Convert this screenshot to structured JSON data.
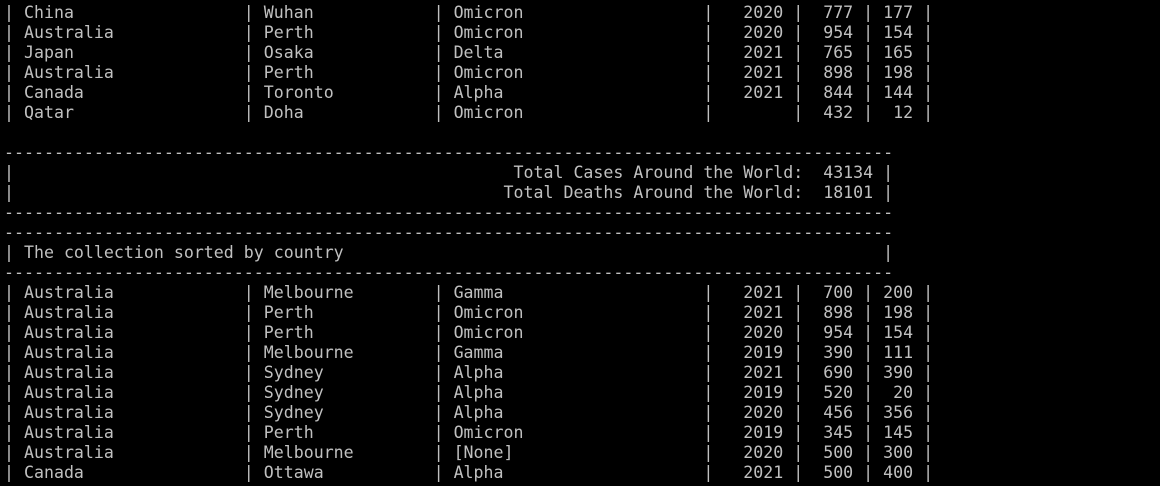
{
  "terminal": {
    "background": "#000000",
    "foreground": "#c0c0c0",
    "lines": [
      "| China                 | Wuhan            | Omicron                  |   2020 |  777 | 177 |",
      "| Australia             | Perth            | Omicron                  |   2020 |  954 | 154 |",
      "| Japan                 | Osaka            | Delta                    |   2021 |  765 | 165 |",
      "| Australia             | Perth            | Omicron                  |   2021 |  898 | 198 |",
      "| Canada                | Toronto          | Alpha                    |   2021 |  844 | 144 |",
      "| Qatar                 | Doha             | Omicron                  |        |  432 |  12 |",
      "",
      "-----------------------------------------------------------------------------------------",
      "|                                                  Total Cases Around the World:  43134 |",
      "|                                                 Total Deaths Around the World:  18101 |",
      "-----------------------------------------------------------------------------------------",
      "-----------------------------------------------------------------------------------------",
      "| The collection sorted by country                                                      |",
      "-----------------------------------------------------------------------------------------",
      "| Australia             | Melbourne        | Gamma                    |   2021 |  700 | 200 |",
      "| Australia             | Perth            | Omicron                  |   2021 |  898 | 198 |",
      "| Australia             | Perth            | Omicron                  |   2020 |  954 | 154 |",
      "| Australia             | Melbourne        | Gamma                    |   2019 |  390 | 111 |",
      "| Australia             | Sydney           | Alpha                    |   2021 |  690 | 390 |",
      "| Australia             | Sydney           | Alpha                    |   2019 |  520 |  20 |",
      "| Australia             | Sydney           | Alpha                    |   2020 |  456 | 356 |",
      "| Australia             | Perth            | Omicron                  |   2019 |  345 | 145 |",
      "| Australia             | Melbourne        | [None]                   |   2020 |  500 | 300 |",
      "| Canada                | Ottawa           | Alpha                    |   2021 |  500 | 400 |"
    ]
  }
}
